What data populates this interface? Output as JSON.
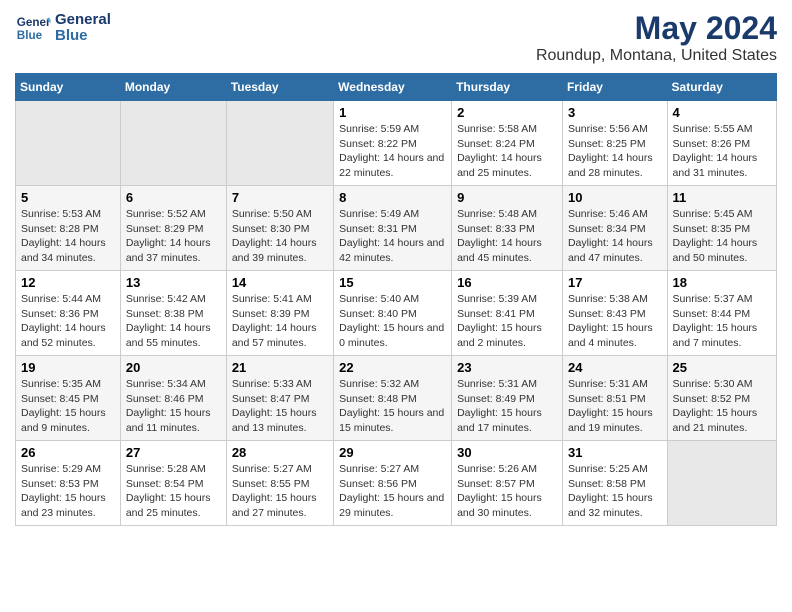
{
  "app": {
    "logo_line1": "General",
    "logo_line2": "Blue",
    "title": "May 2024",
    "subtitle": "Roundup, Montana, United States"
  },
  "calendar": {
    "headers": [
      "Sunday",
      "Monday",
      "Tuesday",
      "Wednesday",
      "Thursday",
      "Friday",
      "Saturday"
    ],
    "weeks": [
      [
        {
          "day": "",
          "sunrise": "",
          "sunset": "",
          "daylight": "",
          "empty": true
        },
        {
          "day": "",
          "sunrise": "",
          "sunset": "",
          "daylight": "",
          "empty": true
        },
        {
          "day": "",
          "sunrise": "",
          "sunset": "",
          "daylight": "",
          "empty": true
        },
        {
          "day": "1",
          "sunrise": "Sunrise: 5:59 AM",
          "sunset": "Sunset: 8:22 PM",
          "daylight": "Daylight: 14 hours and 22 minutes."
        },
        {
          "day": "2",
          "sunrise": "Sunrise: 5:58 AM",
          "sunset": "Sunset: 8:24 PM",
          "daylight": "Daylight: 14 hours and 25 minutes."
        },
        {
          "day": "3",
          "sunrise": "Sunrise: 5:56 AM",
          "sunset": "Sunset: 8:25 PM",
          "daylight": "Daylight: 14 hours and 28 minutes."
        },
        {
          "day": "4",
          "sunrise": "Sunrise: 5:55 AM",
          "sunset": "Sunset: 8:26 PM",
          "daylight": "Daylight: 14 hours and 31 minutes."
        }
      ],
      [
        {
          "day": "5",
          "sunrise": "Sunrise: 5:53 AM",
          "sunset": "Sunset: 8:28 PM",
          "daylight": "Daylight: 14 hours and 34 minutes."
        },
        {
          "day": "6",
          "sunrise": "Sunrise: 5:52 AM",
          "sunset": "Sunset: 8:29 PM",
          "daylight": "Daylight: 14 hours and 37 minutes."
        },
        {
          "day": "7",
          "sunrise": "Sunrise: 5:50 AM",
          "sunset": "Sunset: 8:30 PM",
          "daylight": "Daylight: 14 hours and 39 minutes."
        },
        {
          "day": "8",
          "sunrise": "Sunrise: 5:49 AM",
          "sunset": "Sunset: 8:31 PM",
          "daylight": "Daylight: 14 hours and 42 minutes."
        },
        {
          "day": "9",
          "sunrise": "Sunrise: 5:48 AM",
          "sunset": "Sunset: 8:33 PM",
          "daylight": "Daylight: 14 hours and 45 minutes."
        },
        {
          "day": "10",
          "sunrise": "Sunrise: 5:46 AM",
          "sunset": "Sunset: 8:34 PM",
          "daylight": "Daylight: 14 hours and 47 minutes."
        },
        {
          "day": "11",
          "sunrise": "Sunrise: 5:45 AM",
          "sunset": "Sunset: 8:35 PM",
          "daylight": "Daylight: 14 hours and 50 minutes."
        }
      ],
      [
        {
          "day": "12",
          "sunrise": "Sunrise: 5:44 AM",
          "sunset": "Sunset: 8:36 PM",
          "daylight": "Daylight: 14 hours and 52 minutes."
        },
        {
          "day": "13",
          "sunrise": "Sunrise: 5:42 AM",
          "sunset": "Sunset: 8:38 PM",
          "daylight": "Daylight: 14 hours and 55 minutes."
        },
        {
          "day": "14",
          "sunrise": "Sunrise: 5:41 AM",
          "sunset": "Sunset: 8:39 PM",
          "daylight": "Daylight: 14 hours and 57 minutes."
        },
        {
          "day": "15",
          "sunrise": "Sunrise: 5:40 AM",
          "sunset": "Sunset: 8:40 PM",
          "daylight": "Daylight: 15 hours and 0 minutes."
        },
        {
          "day": "16",
          "sunrise": "Sunrise: 5:39 AM",
          "sunset": "Sunset: 8:41 PM",
          "daylight": "Daylight: 15 hours and 2 minutes."
        },
        {
          "day": "17",
          "sunrise": "Sunrise: 5:38 AM",
          "sunset": "Sunset: 8:43 PM",
          "daylight": "Daylight: 15 hours and 4 minutes."
        },
        {
          "day": "18",
          "sunrise": "Sunrise: 5:37 AM",
          "sunset": "Sunset: 8:44 PM",
          "daylight": "Daylight: 15 hours and 7 minutes."
        }
      ],
      [
        {
          "day": "19",
          "sunrise": "Sunrise: 5:35 AM",
          "sunset": "Sunset: 8:45 PM",
          "daylight": "Daylight: 15 hours and 9 minutes."
        },
        {
          "day": "20",
          "sunrise": "Sunrise: 5:34 AM",
          "sunset": "Sunset: 8:46 PM",
          "daylight": "Daylight: 15 hours and 11 minutes."
        },
        {
          "day": "21",
          "sunrise": "Sunrise: 5:33 AM",
          "sunset": "Sunset: 8:47 PM",
          "daylight": "Daylight: 15 hours and 13 minutes."
        },
        {
          "day": "22",
          "sunrise": "Sunrise: 5:32 AM",
          "sunset": "Sunset: 8:48 PM",
          "daylight": "Daylight: 15 hours and 15 minutes."
        },
        {
          "day": "23",
          "sunrise": "Sunrise: 5:31 AM",
          "sunset": "Sunset: 8:49 PM",
          "daylight": "Daylight: 15 hours and 17 minutes."
        },
        {
          "day": "24",
          "sunrise": "Sunrise: 5:31 AM",
          "sunset": "Sunset: 8:51 PM",
          "daylight": "Daylight: 15 hours and 19 minutes."
        },
        {
          "day": "25",
          "sunrise": "Sunrise: 5:30 AM",
          "sunset": "Sunset: 8:52 PM",
          "daylight": "Daylight: 15 hours and 21 minutes."
        }
      ],
      [
        {
          "day": "26",
          "sunrise": "Sunrise: 5:29 AM",
          "sunset": "Sunset: 8:53 PM",
          "daylight": "Daylight: 15 hours and 23 minutes."
        },
        {
          "day": "27",
          "sunrise": "Sunrise: 5:28 AM",
          "sunset": "Sunset: 8:54 PM",
          "daylight": "Daylight: 15 hours and 25 minutes."
        },
        {
          "day": "28",
          "sunrise": "Sunrise: 5:27 AM",
          "sunset": "Sunset: 8:55 PM",
          "daylight": "Daylight: 15 hours and 27 minutes."
        },
        {
          "day": "29",
          "sunrise": "Sunrise: 5:27 AM",
          "sunset": "Sunset: 8:56 PM",
          "daylight": "Daylight: 15 hours and 29 minutes."
        },
        {
          "day": "30",
          "sunrise": "Sunrise: 5:26 AM",
          "sunset": "Sunset: 8:57 PM",
          "daylight": "Daylight: 15 hours and 30 minutes."
        },
        {
          "day": "31",
          "sunrise": "Sunrise: 5:25 AM",
          "sunset": "Sunset: 8:58 PM",
          "daylight": "Daylight: 15 hours and 32 minutes."
        },
        {
          "day": "",
          "sunrise": "",
          "sunset": "",
          "daylight": "",
          "empty": true
        }
      ]
    ]
  }
}
